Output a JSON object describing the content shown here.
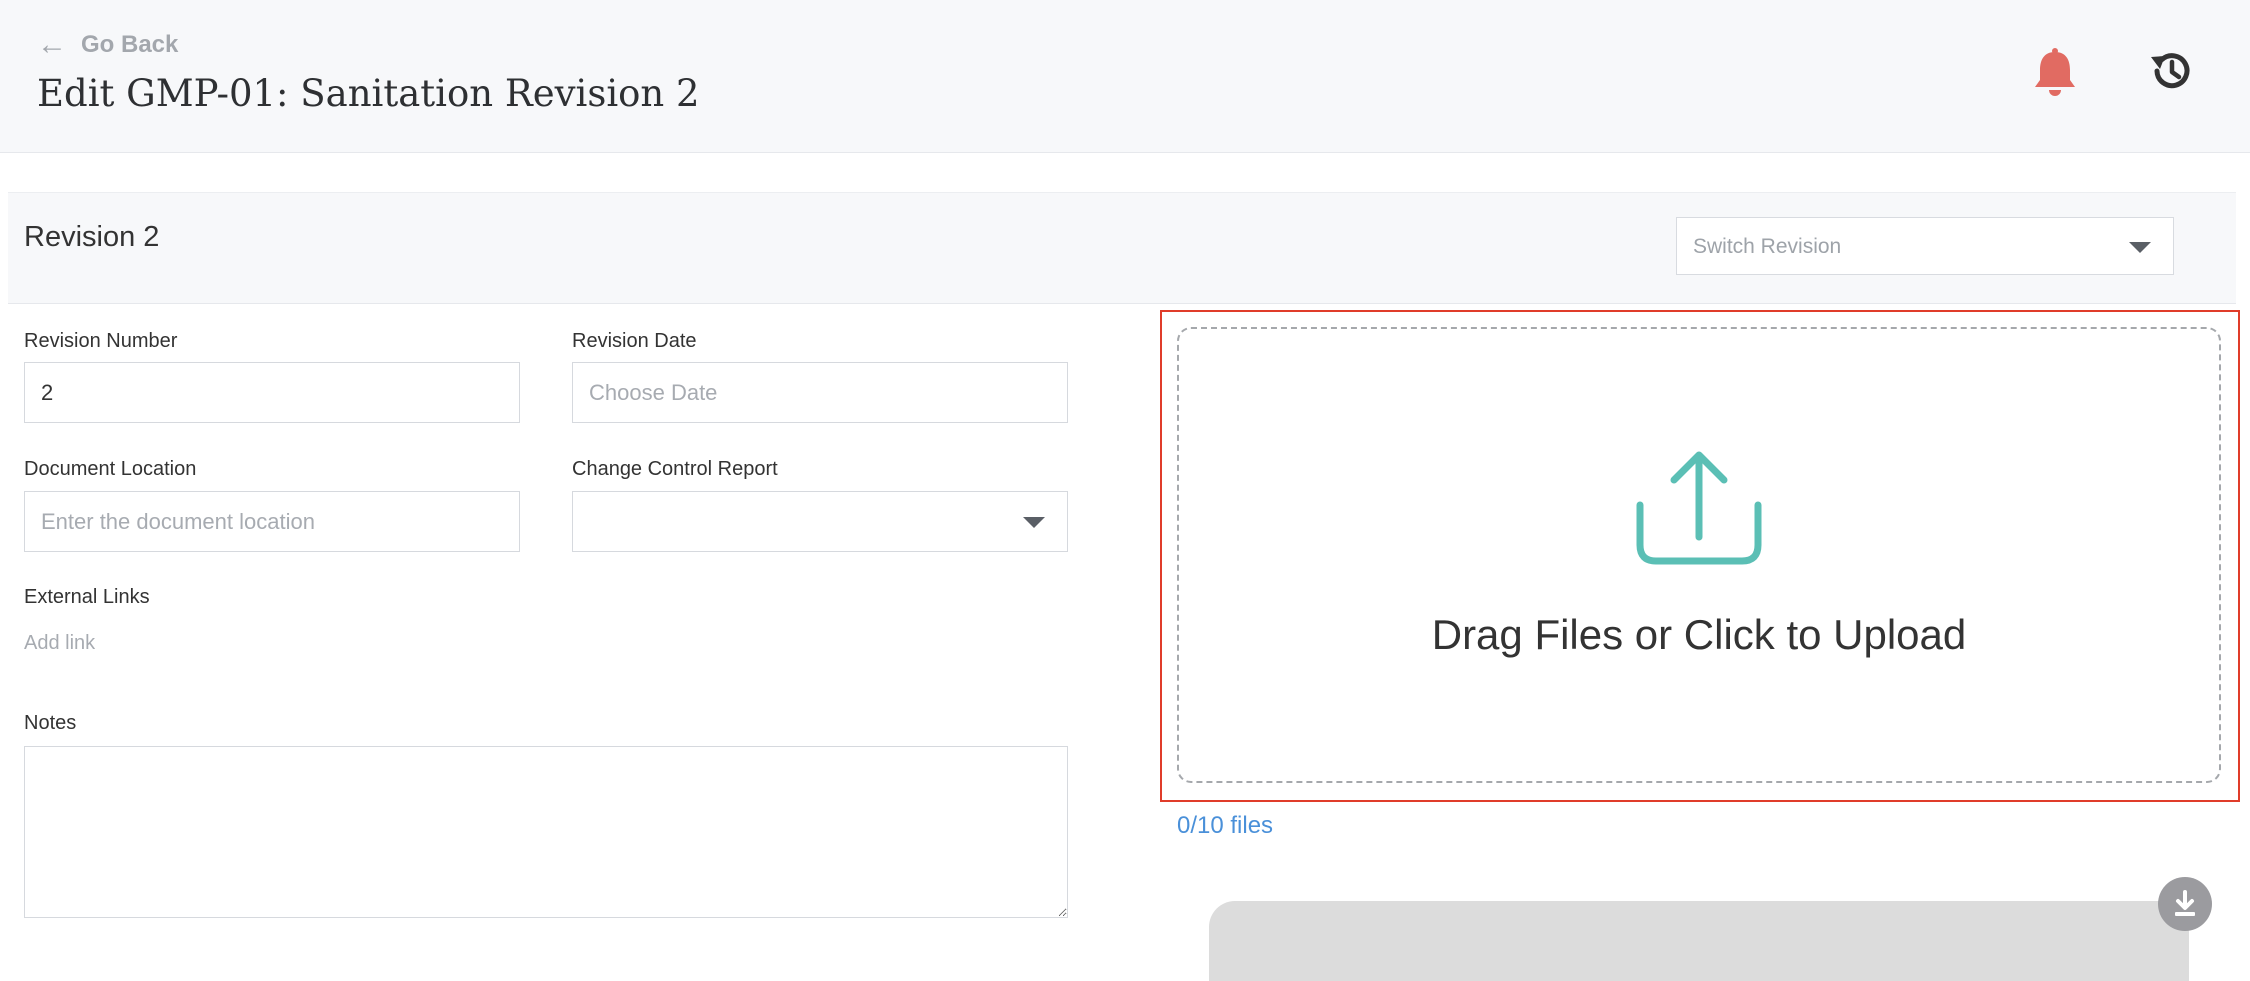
{
  "header": {
    "back_label": "Go Back",
    "title": "Edit GMP-01: Sanitation Revision 2",
    "icons": {
      "back": "arrow-left-icon",
      "notifications": "bell-icon",
      "history": "history-icon"
    },
    "colors": {
      "bell": "#e16b62",
      "history": "#333333"
    }
  },
  "revision": {
    "title": "Revision 2",
    "switch_placeholder": "Switch Revision"
  },
  "form": {
    "revision_number": {
      "label": "Revision Number",
      "value": "2"
    },
    "revision_date": {
      "label": "Revision Date",
      "placeholder": "Choose Date"
    },
    "document_location": {
      "label": "Document Location",
      "placeholder": "Enter the document location"
    },
    "change_control_report": {
      "label": "Change Control Report",
      "value": ""
    },
    "external_links": {
      "label": "External Links",
      "add_label": "Add link"
    },
    "notes": {
      "label": "Notes",
      "value": ""
    }
  },
  "upload": {
    "prompt": "Drag Files or Click to Upload",
    "files_count": "0/10 files",
    "icon": "upload-icon",
    "colors": {
      "icon": "#5bbfb5",
      "files_count": "#4a90d9",
      "highlight": "#e03c2a"
    }
  },
  "fab": {
    "icon": "download-icon"
  }
}
